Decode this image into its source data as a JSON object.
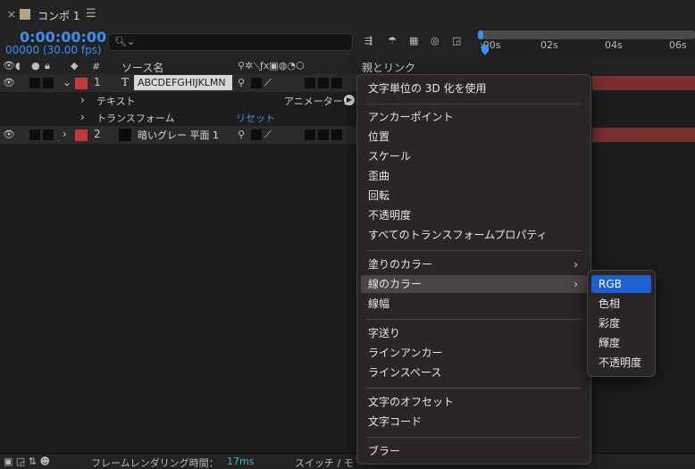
{
  "tab": {
    "close": "×",
    "title": "コンポ 1",
    "menu_icon": "☰"
  },
  "time": {
    "code": "0:00:00:00",
    "frames": "00000 (30.00 fps)"
  },
  "search": {
    "placeholder": ""
  },
  "ruler": {
    "labels": [
      ":00s",
      "02s",
      "04s",
      "06s"
    ]
  },
  "columns": {
    "hash": "#",
    "source_name": "ソース名",
    "parent": "親とリンク"
  },
  "layers": [
    {
      "num": "1",
      "type_icon": "T",
      "name": "ABCDEFGHIJKLMN"
    },
    {
      "num": "2",
      "name": "暗いグレー 平面 1"
    }
  ],
  "props": {
    "text": "テキスト",
    "animator": "アニメーター：",
    "transform": "トランスフォーム",
    "reset": "リセット"
  },
  "menu": {
    "items": [
      "文字単位の 3D 化を使用",
      "アンカーポイント",
      "位置",
      "スケール",
      "歪曲",
      "回転",
      "不透明度",
      "すべてのトランスフォームプロパティ",
      "塗りのカラー",
      "線のカラー",
      "線幅",
      "字送り",
      "ラインアンカー",
      "ラインスペース",
      "文字のオフセット",
      "文字コード",
      "ブラー"
    ]
  },
  "submenu": {
    "items": [
      "RGB",
      "色相",
      "彩度",
      "輝度",
      "不透明度"
    ],
    "selected": "RGB"
  },
  "footer": {
    "render_label": "フレームレンダリング時間：",
    "render_value": "17ms",
    "switch": "スイッチ / モ"
  },
  "colors": {
    "accent": "#3d8ef0",
    "label_red": "#c0393b",
    "selected_blue": "#1e5fd1",
    "green_bar": "#2ea043"
  }
}
